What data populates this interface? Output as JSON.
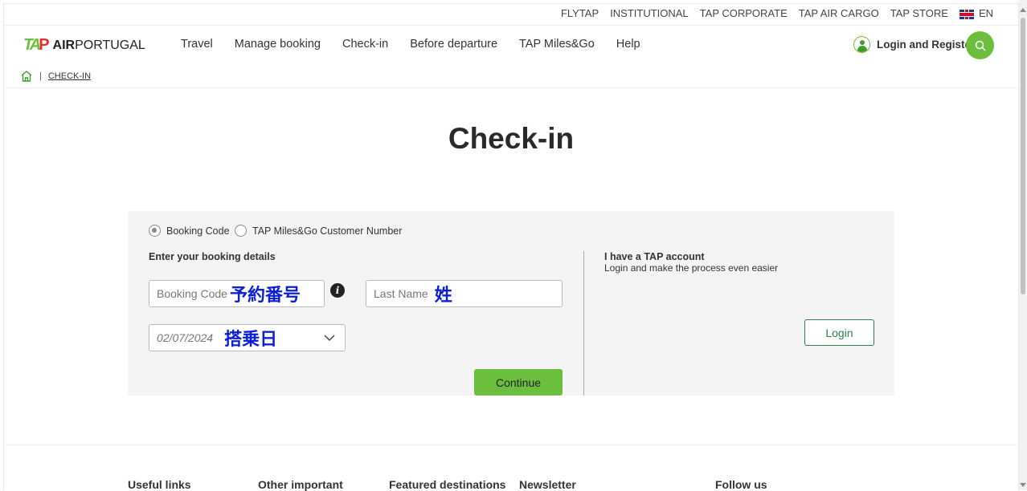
{
  "top_links": [
    "FLYTAP",
    "INSTITUTIONAL",
    "TAP CORPORATE",
    "TAP AIR CARGO",
    "TAP STORE"
  ],
  "language": "EN",
  "logo": {
    "mark": "TAP",
    "text_bold": "AIR",
    "text": "PORTUGAL"
  },
  "nav": [
    "Travel",
    "Manage booking",
    "Check-in",
    "Before departure",
    "TAP Miles&Go",
    "Help"
  ],
  "login_register": "Login and Register",
  "breadcrumb": {
    "current": "CHECK-IN"
  },
  "page_title": "Check-in",
  "form": {
    "radio_booking": "Booking Code",
    "radio_miles": "TAP Miles&Go Customer Number",
    "selected": "Booking Code",
    "section_label": "Enter your booking details",
    "booking_code_placeholder": "Booking Code",
    "booking_code_annotation": "予約番号",
    "last_name_placeholder": "Last Name",
    "last_name_annotation": "姓",
    "date_value": "02/07/2024",
    "date_annotation": "搭乗日",
    "continue": "Continue"
  },
  "account": {
    "title": "I have a TAP account",
    "subtitle": "Login and make the process even easier",
    "login": "Login"
  },
  "footer": [
    "Useful links",
    "Other important",
    "Featured destinations",
    "Newsletter",
    "Follow us"
  ],
  "colors": {
    "accent": "#6cbf3c",
    "login_border": "#2f7d4f",
    "annotation": "#0a1ed8"
  }
}
